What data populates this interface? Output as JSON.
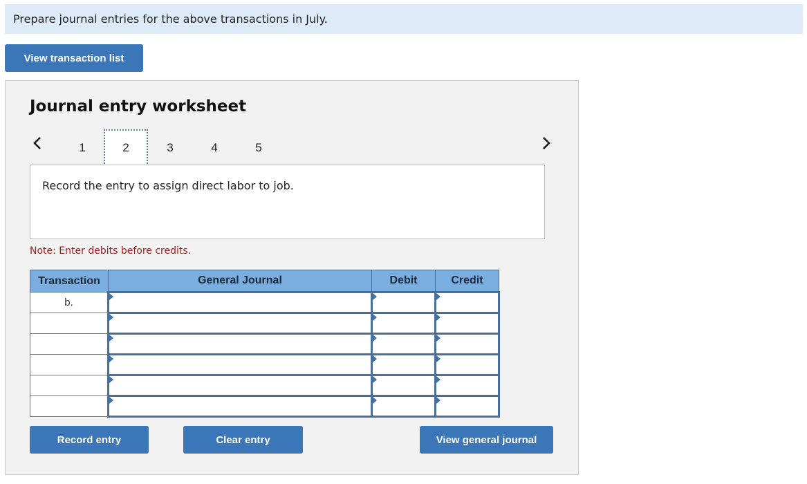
{
  "instruction": "Prepare journal entries for the above transactions in July.",
  "buttons": {
    "view_transaction_list": "View transaction list",
    "record_entry": "Record entry",
    "clear_entry": "Clear entry",
    "view_general_journal": "View general journal"
  },
  "worksheet": {
    "title": "Journal entry worksheet",
    "prev_icon": "chevron-left-icon",
    "next_icon": "chevron-right-icon",
    "steps": [
      "1",
      "2",
      "3",
      "4",
      "5"
    ],
    "active_step": "2",
    "description": "Record the entry to assign direct labor to job.",
    "note": "Note: Enter debits before credits."
  },
  "table": {
    "headers": [
      "Transaction",
      "General Journal",
      "Debit",
      "Credit"
    ],
    "rows": [
      {
        "transaction": "b.",
        "account": "",
        "debit": "",
        "credit": ""
      },
      {
        "transaction": "",
        "account": "",
        "debit": "",
        "credit": ""
      },
      {
        "transaction": "",
        "account": "",
        "debit": "",
        "credit": ""
      },
      {
        "transaction": "",
        "account": "",
        "debit": "",
        "credit": ""
      },
      {
        "transaction": "",
        "account": "",
        "debit": "",
        "credit": ""
      },
      {
        "transaction": "",
        "account": "",
        "debit": "",
        "credit": ""
      }
    ]
  },
  "colors": {
    "button": "#3a76b8",
    "header": "#7aaee0",
    "instruction_bg": "#dcebf7",
    "note": "#a11d1d"
  }
}
